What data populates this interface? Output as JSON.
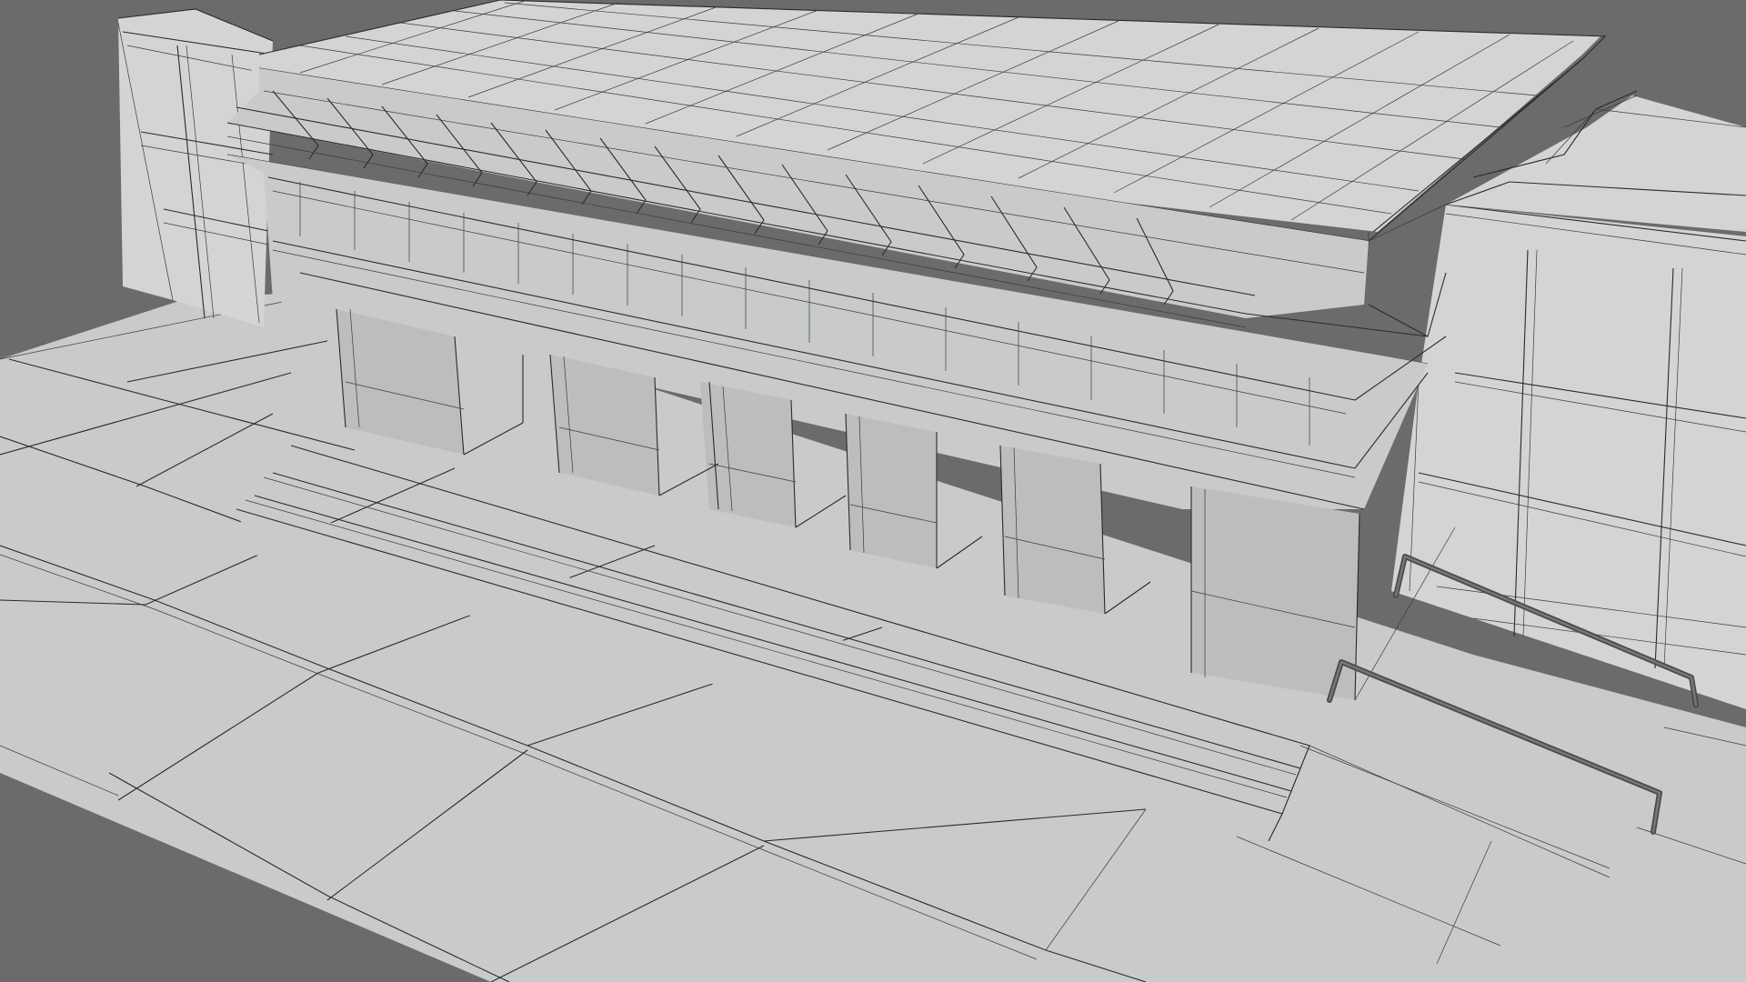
{
  "viewport": {
    "mode": "wireframe-on-shaded",
    "background_color": "#6b6b6b",
    "surface_color": "#c9cbcb",
    "wire_color": "#2a2a2a"
  },
  "scene": {
    "subject": "building-model",
    "handrail_count": 2,
    "step_count": 3
  }
}
